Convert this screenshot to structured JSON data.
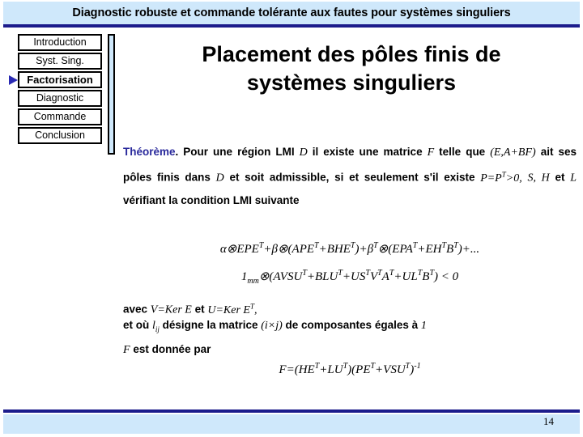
{
  "header": {
    "title": "Diagnostic robuste et commande tolérante aux fautes pour systèmes singuliers",
    "bar_color": "#cfe8fb",
    "rule_color": "#1c1c8c"
  },
  "sidebar": {
    "items": [
      {
        "label": "Introduction",
        "active": false
      },
      {
        "label": "Syst. Sing.",
        "active": false
      },
      {
        "label": "Factorisation",
        "active": true
      },
      {
        "label": "Diagnostic",
        "active": false
      },
      {
        "label": "Commande",
        "active": false
      },
      {
        "label": "Conclusion",
        "active": false
      }
    ],
    "active_marker": "right-triangle-arrow",
    "active_marker_color": "#2a2ab4"
  },
  "slide": {
    "title_line_1": "Placement des pôles finis de",
    "title_line_2": "systèmes singuliers"
  },
  "theorem": {
    "keyword": "Théorème",
    "keyword_color": "#2a2a9c",
    "text_part_1": ". Pour une région LMI ",
    "var_D_1": "D",
    "text_part_2": " il existe une matrice ",
    "var_F_1": "F",
    "text_part_3": " telle que ",
    "expr_EABF": "(E,A+BF)",
    "text_part_4": " ait ses pôles finis dans ",
    "var_D_2": "D",
    "text_part_5": " et soit admissible, si et seulement s'il existe ",
    "expr_P": "P=P",
    "expr_P_sup": "T",
    "expr_P_tail": ">0,",
    "var_S": "S,",
    "var_H": "H",
    "text_part_6": " et ",
    "var_L": "L",
    "text_part_7": " vérifiant la condition LMI suivante"
  },
  "equations": {
    "eq1": {
      "parts": [
        "α⊗EPE",
        "T",
        "+β⊗(APE",
        "T",
        "+BHE",
        "T",
        ")+β",
        "T",
        "⊗(EPA",
        "T",
        "+EH",
        "T",
        "B",
        "T",
        ")+..."
      ],
      "plain": "α⊗EPE T+β⊗(APE T+BHE T)+β T⊗(EPA T+EH TB T)+..."
    },
    "eq2": {
      "plain": "1mm⊗(AVSU T+BLU T+US TV TA T+UL TB T) < 0"
    },
    "eq3": {
      "plain": "F=(HE T+LU T)(PE T+VSU T)-1"
    }
  },
  "notes": {
    "avec_label": "avec ",
    "avec_V": "V=Ker E",
    "avec_et": " et ",
    "avec_U": "U=Ker E",
    "avec_U_sup": "T",
    "avec_comma": ",",
    "etou_label": "et où ",
    "etou_l": "l",
    "etou_l_sub": "ij",
    "etou_mid": " désigne la matrice ",
    "etou_ixj": "(i×j)",
    "etou_tail": " de composantes égales à ",
    "etou_one": "1",
    "fdonnee_F": "F",
    "fdonnee_text": " est donnée par"
  },
  "footer": {
    "page_number": "14",
    "bar_color": "#cfe8fb",
    "rule_color": "#1c1c8c"
  }
}
